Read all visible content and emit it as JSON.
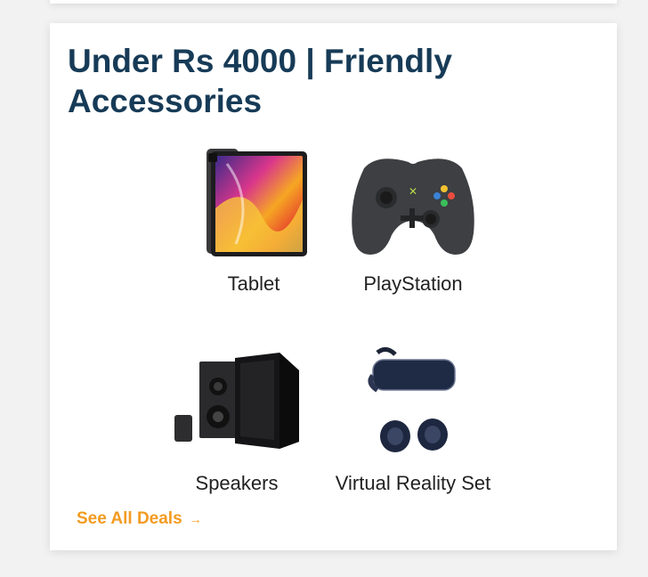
{
  "section": {
    "title": "Under Rs 4000 | Friendly Accessories",
    "items": [
      {
        "label": "Tablet",
        "icon": "tablet-image"
      },
      {
        "label": "PlayStation",
        "icon": "gamepad-image"
      },
      {
        "label": "Speakers",
        "icon": "speakers-image"
      },
      {
        "label": "Virtual Reality Set",
        "icon": "vr-headset-image"
      }
    ],
    "see_all": {
      "label": "See All Deals",
      "icon": "arrow-right-icon"
    }
  },
  "colors": {
    "title": "#173b57",
    "accent": "#f39b20",
    "background": "#f2f2f2"
  }
}
